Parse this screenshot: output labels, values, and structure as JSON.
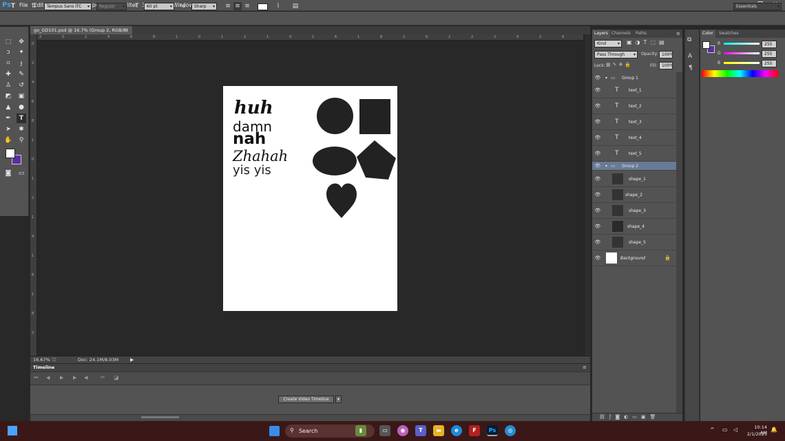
{
  "app": {
    "logo": "Ps"
  },
  "menu": [
    "File",
    "Edit",
    "Image",
    "Layer",
    "Type",
    "Select",
    "Filter",
    "3D",
    "View",
    "Window",
    "Help"
  ],
  "window_controls": {
    "minimize": "–",
    "maximize": "❐",
    "close": "✕"
  },
  "options_bar": {
    "font_family": "Tempus Sans ITC",
    "font_style": "Regular",
    "font_size": "60 pt",
    "antialias": "Sharp",
    "workspace": "Essentials"
  },
  "document": {
    "tab_title": "go_GD101.psd @ 16.7% (Group 2, RGB/8)",
    "tab_close": "×"
  },
  "ruler": {
    "h_ticks": [
      "2",
      "0",
      "2",
      "4",
      "6",
      "8",
      "1",
      "0",
      "1",
      "2",
      "1",
      "4",
      "1",
      "6",
      "1",
      "8",
      "2",
      "0",
      "2",
      "2",
      "2",
      "4",
      "2",
      "6"
    ],
    "v_ticks": [
      "0",
      "2",
      "4",
      "6",
      "8",
      "1",
      "0",
      "1",
      "2",
      "1",
      "4",
      "1",
      "6",
      "1",
      "8",
      "2"
    ]
  },
  "canvas_text": {
    "line1": "huh",
    "line2": "damn",
    "line3": "nah",
    "line4": "Zhahah",
    "line5": "yis yis"
  },
  "status": {
    "zoom": "16.67%",
    "doc": "Doc: 24.1M/8.03M"
  },
  "timeline": {
    "title": "Timeline",
    "create_button": "Create Video Timeline"
  },
  "layers_panel": {
    "tabs": [
      "Layers",
      "Channels",
      "Paths"
    ],
    "filter_kind": "Kind",
    "blend_mode": "Pass Through",
    "opacity_label": "Opacity:",
    "opacity_value": "100%",
    "lock_label": "Lock:",
    "fill_label": "Fill:",
    "fill_value": "100%",
    "layers": [
      {
        "name": "Group 1",
        "type": "group"
      },
      {
        "name": "text_1",
        "type": "text"
      },
      {
        "name": "text_2",
        "type": "text"
      },
      {
        "name": "text_3",
        "type": "text"
      },
      {
        "name": "text_4",
        "type": "text"
      },
      {
        "name": "text_5",
        "type": "text"
      },
      {
        "name": "Group 2",
        "type": "group",
        "selected": true
      },
      {
        "name": "shape_1",
        "type": "shape"
      },
      {
        "name": "shape_2",
        "type": "shape"
      },
      {
        "name": "shape_3",
        "type": "shape"
      },
      {
        "name": "shape_4",
        "type": "shape"
      },
      {
        "name": "shape_5",
        "type": "shape"
      },
      {
        "name": "Background",
        "type": "background"
      }
    ]
  },
  "color_panel": {
    "tabs": [
      "Color",
      "Swatches"
    ],
    "r_label": "R",
    "r_value": "255",
    "g_label": "G",
    "g_value": "255",
    "b_label": "B",
    "b_value": "255",
    "foreground": "#ffffff",
    "background": "#5b2f9e"
  },
  "taskbar": {
    "search_placeholder": "Search",
    "time": "10:14 AM",
    "date": "2/1/2025"
  },
  "colors": {
    "accent": "#31a8ff",
    "selected_layer": "#687a94",
    "shape_fill": "#222222"
  }
}
